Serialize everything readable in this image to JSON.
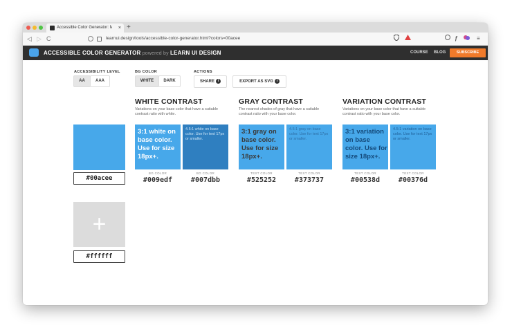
{
  "browser": {
    "tab_title": "Accessible Color Generator: Mak",
    "tab_close": "×",
    "new_tab": "+",
    "url": "learnui.design/tools/accessible-color-generator.html?colors=00acee",
    "back": "◁",
    "forward": "▷",
    "reload": "C"
  },
  "header": {
    "title": "ACCESSIBLE COLOR GENERATOR",
    "powered": " powered by ",
    "brand": "LEARN UI DESIGN",
    "course": "COURSE",
    "blog": "BLOG",
    "subscribe": "SUBSCRIBE"
  },
  "controls": {
    "accessibility_label": "ACCESSIBILITY LEVEL",
    "aa": "AA",
    "aaa": "AAA",
    "bg_label": "BG COLOR",
    "white": "WHITE",
    "dark": "DARK",
    "actions_label": "ACTIONS",
    "share": "SHARE",
    "export": "EXPORT AS SVG",
    "info_glyph": "i"
  },
  "base": {
    "color": "#00acee",
    "hex": "#00acee",
    "second_hex": "#ffffff",
    "add_glyph": "+"
  },
  "sections": [
    {
      "title": "WHITE CONTRAST",
      "desc": "Variations on your base color that have a suitable contrast ratio with white.",
      "tiles": [
        {
          "color": "#47a8ea",
          "text": "3:1 white on base color. Use for size 18px+.",
          "label": "BG COLOR",
          "hex": "#009edf"
        },
        {
          "color": "#2f7fc0",
          "text": "4.5:1 white on base color. Use for text 17px or smaller.",
          "label": "BG COLOR",
          "hex": "#007dbb"
        }
      ]
    },
    {
      "title": "GRAY CONTRAST",
      "desc": "The nearest shades of gray that have a suitable contrast ratio with your base color.",
      "tiles": [
        {
          "color": "#47a8ea",
          "text": "3:1 gray on base color. Use for size 18px+.",
          "label": "TEXT COLOR",
          "hex": "#525252"
        },
        {
          "color": "#47a8ea",
          "text": "4.5:1 gray on base color. Use for text 17px or smaller.",
          "label": "TEXT COLOR",
          "hex": "#373737"
        }
      ]
    },
    {
      "title": "VARIATION CONTRAST",
      "desc": "Variations on your base color that have a suitable contrast ratio with your base color.",
      "tiles": [
        {
          "color": "#47a8ea",
          "text": "3:1 variation on base color. Use for size 18px+.",
          "label": "TEXT COLOR",
          "hex": "#00538d"
        },
        {
          "color": "#47a8ea",
          "text": "4.5:1 variation on base color. Use for text 17px or smaller.",
          "label": "TEXT COLOR",
          "hex": "#00376d"
        }
      ]
    }
  ]
}
